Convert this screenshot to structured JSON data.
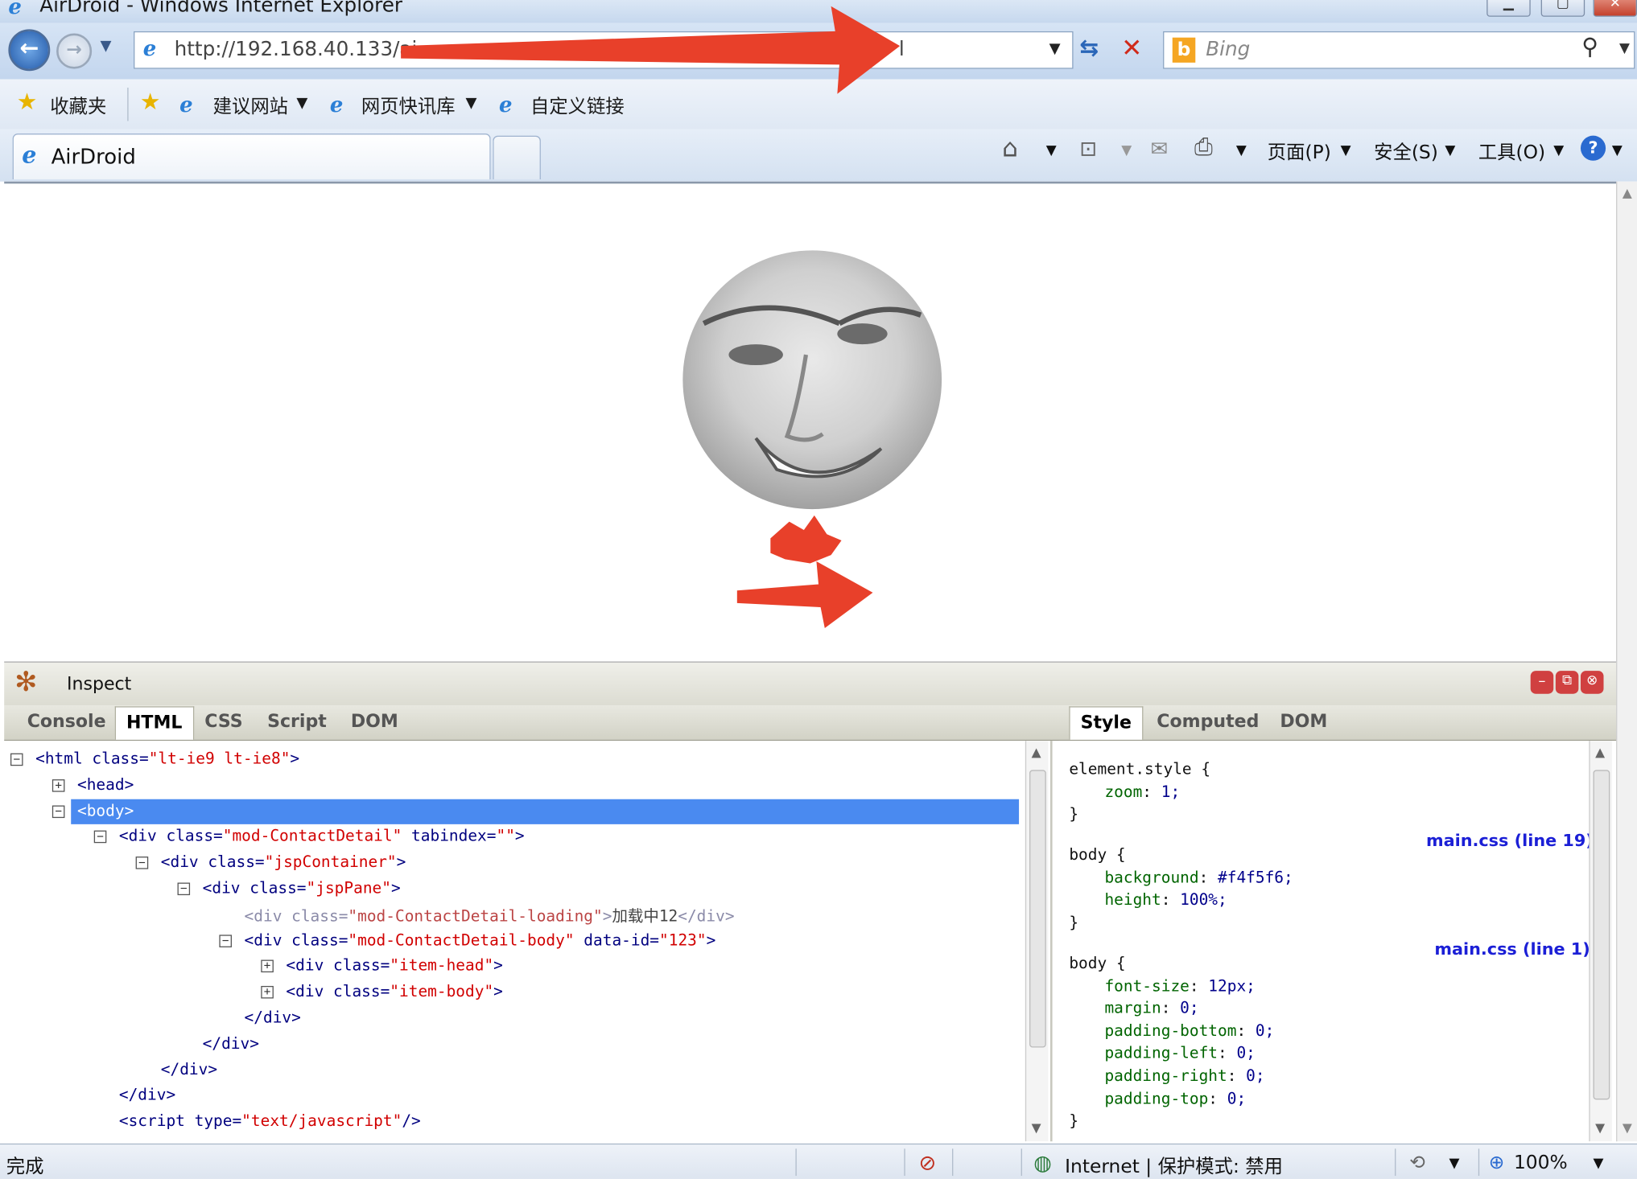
{
  "window": {
    "title": "AirDroid - Windows Internet Explorer"
  },
  "address": {
    "url": "http://192.168.40.133/ai",
    "url_tail": "l",
    "search_placeholder": "Bing"
  },
  "favorites": {
    "favorites_label": "收藏夹",
    "suggested": "建议网站",
    "webslice": "网页快讯库",
    "custom": "自定义链接"
  },
  "tabs": [
    {
      "label": "AirDroid"
    }
  ],
  "commandbar": {
    "page": "页面(P)",
    "safety": "安全(S)",
    "tools": "工具(O)"
  },
  "firebug": {
    "inspect_label": "Inspect",
    "tabs": [
      "Console",
      "HTML",
      "CSS",
      "Script",
      "DOM"
    ],
    "side_tabs": [
      "Style",
      "Computed",
      "DOM"
    ],
    "html_lines": [
      {
        "indent": 0,
        "toggle": "-",
        "parts": [
          [
            "t",
            "<html "
          ],
          [
            "a",
            "class="
          ],
          [
            "v",
            "\"lt-ie9 lt-ie8\""
          ],
          [
            "t",
            ">"
          ]
        ]
      },
      {
        "indent": 1,
        "toggle": "+",
        "parts": [
          [
            "t",
            "<head>"
          ]
        ]
      },
      {
        "indent": 1,
        "toggle": "-",
        "parts": [
          [
            "t",
            "<body>"
          ]
        ],
        "selected": true
      },
      {
        "indent": 2,
        "toggle": "-",
        "parts": [
          [
            "t",
            "<div "
          ],
          [
            "a",
            "class="
          ],
          [
            "v",
            "\"mod-ContactDetail\""
          ],
          [
            "a",
            " tabindex="
          ],
          [
            "v",
            "\"\""
          ],
          [
            "t",
            ">"
          ]
        ]
      },
      {
        "indent": 3,
        "toggle": "-",
        "parts": [
          [
            "t",
            "<div "
          ],
          [
            "a",
            "class="
          ],
          [
            "v",
            "\"jspContainer\""
          ],
          [
            "t",
            ">"
          ]
        ]
      },
      {
        "indent": 4,
        "toggle": "-",
        "parts": [
          [
            "t",
            "<div "
          ],
          [
            "a",
            "class="
          ],
          [
            "v",
            "\"jspPane\""
          ],
          [
            "t",
            ">"
          ]
        ]
      },
      {
        "indent": 5,
        "toggle": "",
        "parts": [
          [
            "d",
            "<div "
          ],
          [
            "d",
            "class="
          ],
          [
            "v2",
            "\"mod-ContactDetail-loading\""
          ],
          [
            "d",
            ">"
          ],
          [
            "txt",
            "加载中12"
          ],
          [
            "d",
            "</div>"
          ]
        ]
      },
      {
        "indent": 5,
        "toggle": "-",
        "parts": [
          [
            "t",
            "<div "
          ],
          [
            "a",
            "class="
          ],
          [
            "v",
            "\"mod-ContactDetail-body\""
          ],
          [
            "a",
            " data-id="
          ],
          [
            "v",
            "\"123\""
          ],
          [
            "t",
            ">"
          ]
        ]
      },
      {
        "indent": 6,
        "toggle": "+",
        "parts": [
          [
            "t",
            "<div "
          ],
          [
            "a",
            "class="
          ],
          [
            "v",
            "\"item-head\""
          ],
          [
            "t",
            ">"
          ]
        ]
      },
      {
        "indent": 6,
        "toggle": "+",
        "parts": [
          [
            "t",
            "<div "
          ],
          [
            "a",
            "class="
          ],
          [
            "v",
            "\"item-body\""
          ],
          [
            "t",
            ">"
          ]
        ]
      },
      {
        "indent": 5,
        "toggle": "",
        "parts": [
          [
            "t",
            "</div>"
          ]
        ]
      },
      {
        "indent": 4,
        "toggle": "",
        "parts": [
          [
            "t",
            "</div>"
          ]
        ]
      },
      {
        "indent": 3,
        "toggle": "",
        "parts": [
          [
            "t",
            "</div>"
          ]
        ]
      },
      {
        "indent": 2,
        "toggle": "",
        "parts": [
          [
            "t",
            "</div>"
          ]
        ]
      },
      {
        "indent": 2,
        "toggle": "",
        "parts": [
          [
            "t",
            "<script "
          ],
          [
            "a",
            "type="
          ],
          [
            "v",
            "\"text/javascript\""
          ],
          [
            "t",
            "/>"
          ]
        ]
      }
    ],
    "style": {
      "element_style": {
        "selector": "element.style {",
        "rules": [
          [
            "zoom",
            "1;"
          ]
        ]
      },
      "rule1": {
        "source": "main.css (line 19)",
        "selector": "body {",
        "rules": [
          [
            "background",
            "#f4f5f6;"
          ],
          [
            "height",
            "100%;"
          ]
        ]
      },
      "rule2": {
        "source": "main.css (line 1)",
        "selector": "body {",
        "rules": [
          [
            "font-size",
            "12px;"
          ],
          [
            "margin",
            "0;"
          ],
          [
            "padding-bottom",
            "0;"
          ],
          [
            "padding-left",
            "0;"
          ],
          [
            "padding-right",
            "0;"
          ],
          [
            "padding-top",
            "0;"
          ]
        ]
      },
      "close_brace": "}"
    }
  },
  "statusbar": {
    "status": "完成",
    "zone": "Internet | 保护模式: 禁用",
    "zoom": "100%"
  },
  "colors": {
    "annotation_arrow": "#e8402a",
    "selection": "#4a8af0"
  }
}
